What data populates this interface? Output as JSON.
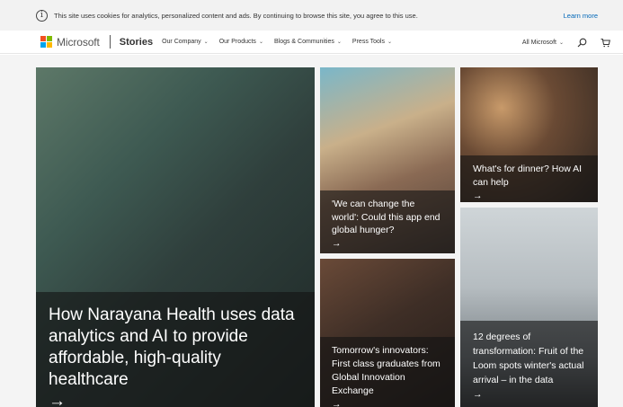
{
  "cookie_bar": {
    "info_icon": "info-circle-icon",
    "text": "This site uses cookies for analytics, personalized content and ads. By continuing to browse this site, you agree to this use.",
    "link": "Learn more"
  },
  "nav": {
    "brand": "Microsoft",
    "section": "Stories",
    "menu": [
      {
        "label": "Our Company"
      },
      {
        "label": "Our Products"
      },
      {
        "label": "Blogs & Communities"
      },
      {
        "label": "Press Tools"
      }
    ],
    "all_microsoft": "All Microsoft",
    "icons": [
      "search-icon",
      "cart-icon"
    ],
    "logo_colors": [
      "#f25022",
      "#7fba00",
      "#00a4ef",
      "#ffb900"
    ]
  },
  "tiles": {
    "main": {
      "title": "How Narayana Health uses data analytics and AI to provide affordable, high-quality healthcare",
      "arrow": "→"
    },
    "hunger": {
      "title": "'We can change the world': Could this app end global hunger?",
      "arrow": "→"
    },
    "dinner": {
      "title": "What's for dinner? How AI can help",
      "arrow": "→"
    },
    "innovators": {
      "title": "Tomorrow's innovators: First class graduates from Global Innovation Exchange",
      "arrow": "→"
    },
    "loom": {
      "title": "12 degrees of transformation: Fruit of the Loom spots winter's actual arrival – in the data",
      "arrow": "→"
    }
  }
}
